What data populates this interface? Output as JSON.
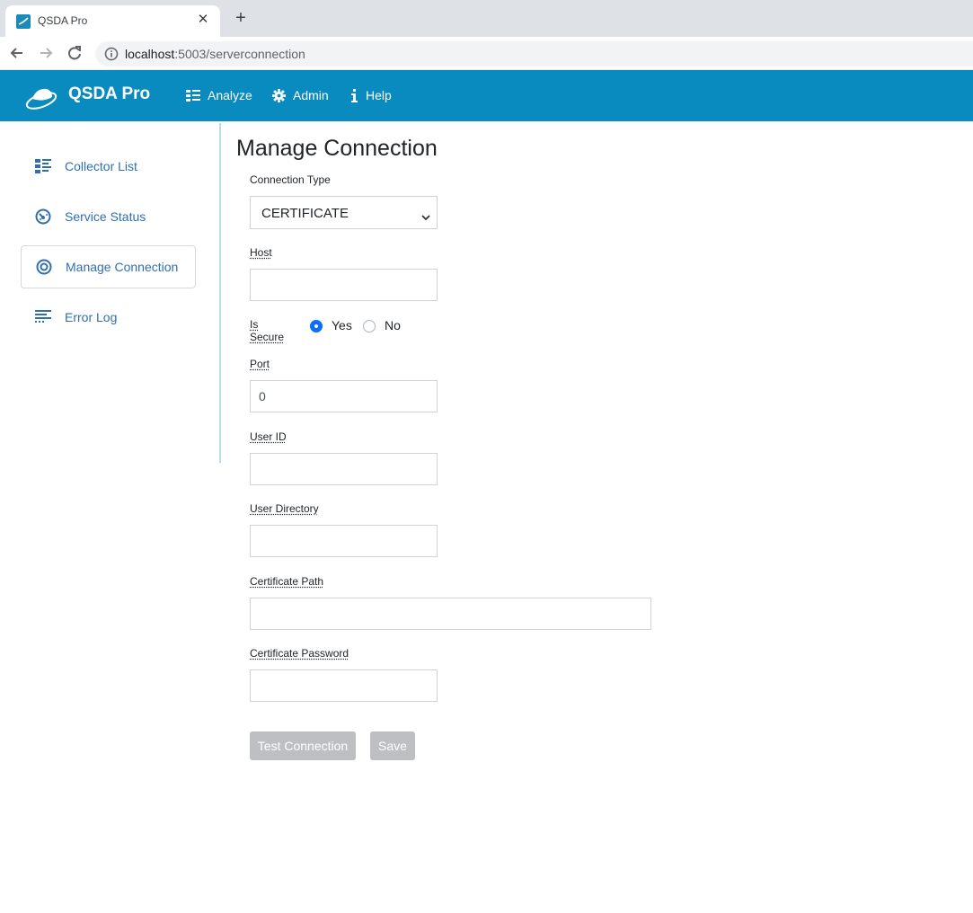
{
  "browser": {
    "tab_title": "QSDA Pro",
    "tab_close": "✕",
    "new_tab": "+",
    "url_host": "localhost",
    "url_rest": ":5003/serverconnection"
  },
  "navbar": {
    "brand": "QSDA Pro",
    "items": [
      {
        "label": "Analyze",
        "icon": "list-icon"
      },
      {
        "label": "Admin",
        "icon": "gear-icon"
      },
      {
        "label": "Help",
        "icon": "info-icon"
      }
    ]
  },
  "sidebar": {
    "items": [
      {
        "label": "Collector List",
        "icon": "collector-list-icon",
        "active": false
      },
      {
        "label": "Service Status",
        "icon": "service-status-icon",
        "active": false
      },
      {
        "label": "Manage Connection",
        "icon": "manage-connection-icon",
        "active": true
      },
      {
        "label": "Error Log",
        "icon": "error-log-icon",
        "active": false
      }
    ]
  },
  "form": {
    "title": "Manage Connection",
    "connection_type_label": "Connection Type",
    "connection_type_value": "CERTIFICATE",
    "host_label": "Host",
    "host_value": "",
    "is_secure_label": "Is Secure",
    "is_secure_yes": "Yes",
    "is_secure_no": "No",
    "is_secure_selected": "Yes",
    "port_label": "Port",
    "port_value": "0",
    "user_id_label": "User ID",
    "user_id_value": "",
    "user_directory_label": "User Directory",
    "user_directory_value": "",
    "certificate_path_label": "Certificate Path",
    "certificate_path_value": "",
    "certificate_password_label": "Certificate Password",
    "certificate_password_value": "",
    "test_button": "Test Connection",
    "save_button": "Save"
  },
  "colors": {
    "navbar": "#0a8bbf",
    "sidebar_text": "#2f6fb0",
    "button_disabled": "#bdbfc2",
    "radio_selected": "#0d6efd"
  }
}
